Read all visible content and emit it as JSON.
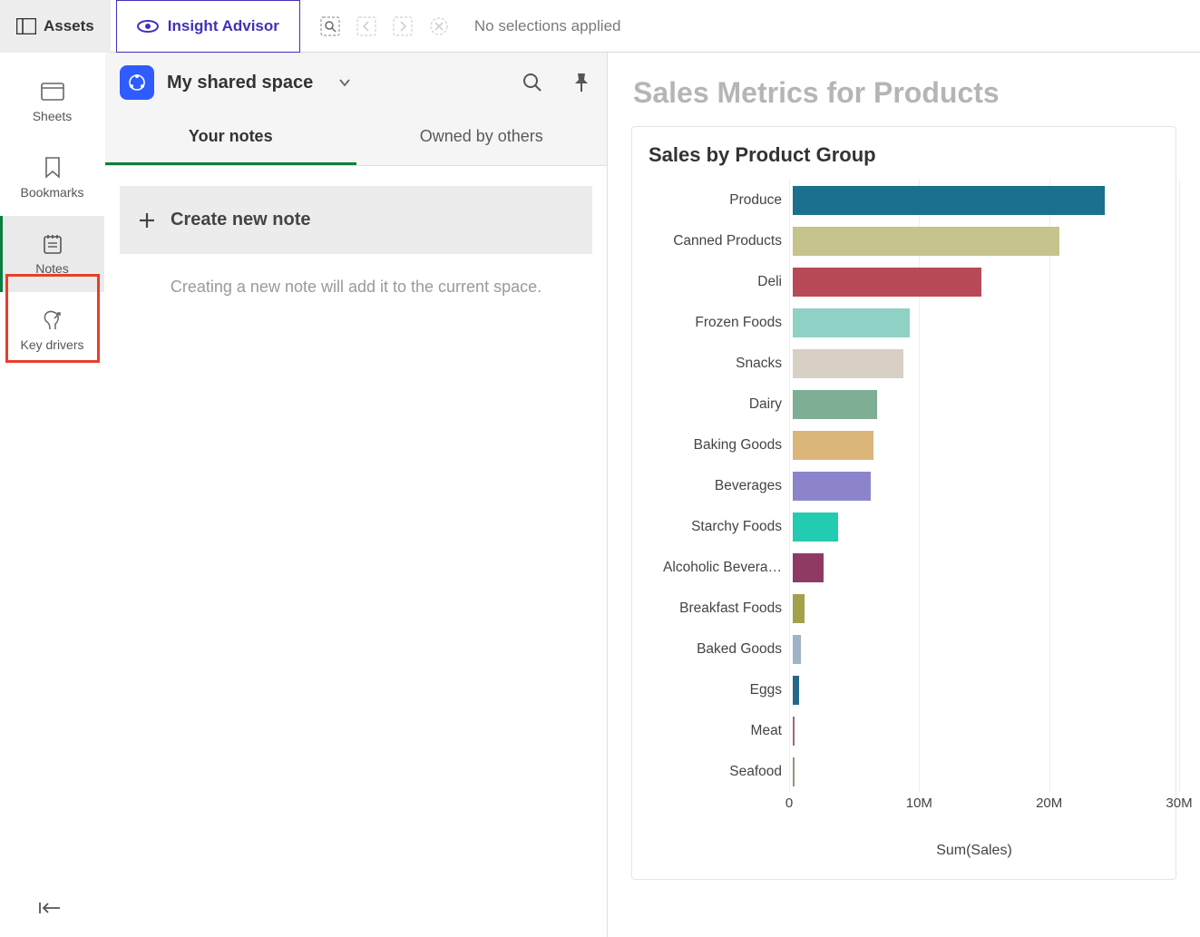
{
  "topbar": {
    "assets_label": "Assets",
    "insight_label": "Insight Advisor",
    "no_selections": "No selections applied"
  },
  "rail": {
    "items": [
      {
        "id": "sheets",
        "label": "Sheets"
      },
      {
        "id": "bookmarks",
        "label": "Bookmarks"
      },
      {
        "id": "notes",
        "label": "Notes"
      },
      {
        "id": "key-drivers",
        "label": "Key drivers"
      }
    ],
    "selected": "notes"
  },
  "panel": {
    "space_name": "My shared space",
    "tabs": [
      {
        "id": "your-notes",
        "label": "Your notes",
        "active": true
      },
      {
        "id": "owned-by-others",
        "label": "Owned by others",
        "active": false
      }
    ],
    "create_label": "Create new note",
    "hint": "Creating a new note will add it to the current space."
  },
  "content": {
    "page_title": "Sales Metrics for Products",
    "chart_title": "Sales by Product Group"
  },
  "chart_data": {
    "type": "bar",
    "orientation": "horizontal",
    "title": "Sales by Product Group",
    "ylabel": "",
    "xlabel": "Sum(Sales)",
    "xlim": [
      0,
      30000000
    ],
    "xticks": [
      0,
      10000000,
      20000000,
      30000000
    ],
    "xtick_labels": [
      "0",
      "10M",
      "20M",
      "30M"
    ],
    "categories": [
      "Produce",
      "Canned Products",
      "Deli",
      "Frozen Foods",
      "Snacks",
      "Dairy",
      "Baking Goods",
      "Beverages",
      "Starchy Foods",
      "Alcoholic Bevera…",
      "Breakfast Foods",
      "Baked Goods",
      "Eggs",
      "Meat",
      "Seafood"
    ],
    "values": [
      24000000,
      20500000,
      14500000,
      9000000,
      8500000,
      6500000,
      6200000,
      6000000,
      3500000,
      2400000,
      900000,
      600000,
      500000,
      150000,
      100000
    ],
    "colors": [
      "#1b6f8f",
      "#c6c48c",
      "#b84a58",
      "#8fd1c5",
      "#d9d0c5",
      "#7eae93",
      "#dbb57a",
      "#8b84cc",
      "#23ccb0",
      "#8f3a63",
      "#a5a14a",
      "#9fb3c7",
      "#26668f",
      "#a06a6a",
      "#9a937e"
    ]
  }
}
